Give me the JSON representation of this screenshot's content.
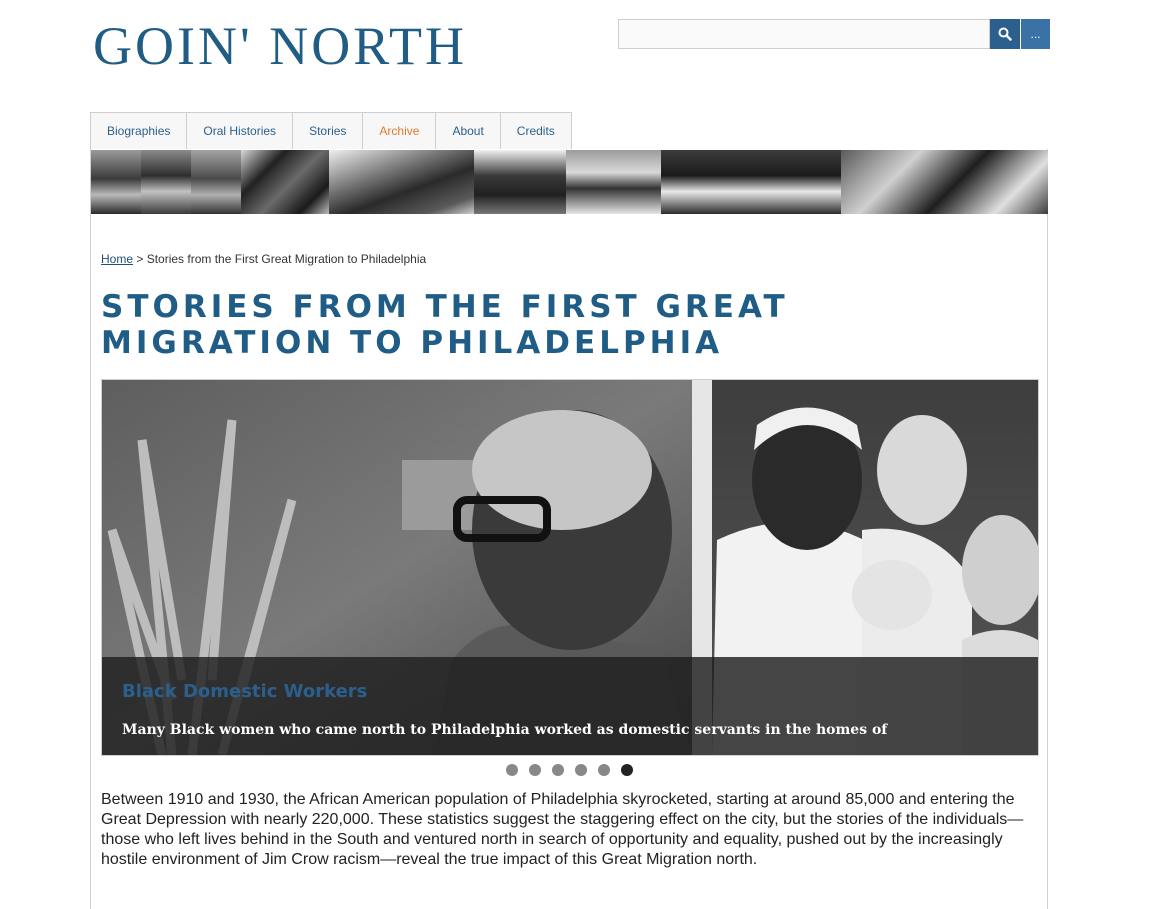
{
  "site": {
    "title": "GOIN' NORTH"
  },
  "search": {
    "placeholder": "",
    "more_label": "..."
  },
  "nav": {
    "items": [
      {
        "label": "Biographies"
      },
      {
        "label": "Oral Histories"
      },
      {
        "label": "Stories"
      },
      {
        "label": "Archive"
      },
      {
        "label": "About"
      },
      {
        "label": "Credits"
      }
    ],
    "active": "Archive"
  },
  "breadcrumb": {
    "home": "Home",
    "separator": " > ",
    "current": "Stories from the First Great Migration to Philadelphia"
  },
  "page": {
    "title": "Stories from the First Great Migration to Philadelphia"
  },
  "slider": {
    "caption_title": "Black Domestic Workers",
    "caption_text": "Many Black women who came north to Philadelphia worked as domestic servants in the homes of",
    "dot_count": 6,
    "active_index": 5
  },
  "intro": "Between 1910 and 1930, the African American population of Philadelphia skyrocketed, starting at around 85,000 and entering the Great Depression with nearly 220,000. These statistics suggest the staggering effect on the city, but the stories of the individuals—those who left lives behind in the South and ventured north in search of opportunity and equality, pushed out by the increasingly hostile environment of Jim Crow racism—reveal the true impact of this Great Migration north.",
  "colors": {
    "brand": "#1f5c86",
    "active_nav": "#e07b2e",
    "button": "#2b5f8e"
  }
}
